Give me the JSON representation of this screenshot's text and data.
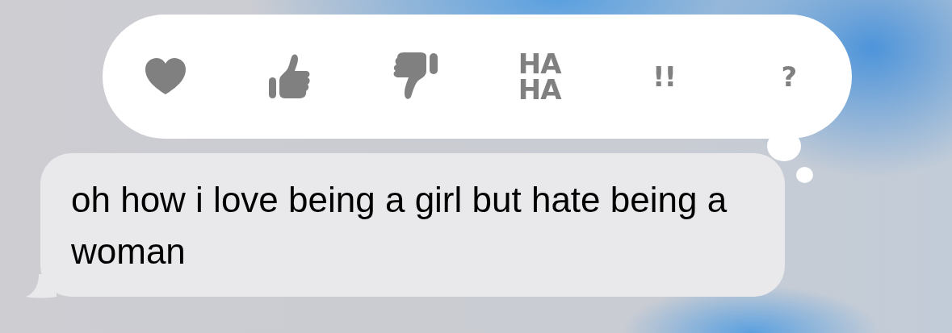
{
  "tapbacks": [
    {
      "kind": "heart"
    },
    {
      "kind": "thumbs_up"
    },
    {
      "kind": "thumbs_down"
    },
    {
      "kind": "text",
      "label": "HA HA"
    },
    {
      "kind": "text",
      "label": "!!"
    },
    {
      "kind": "text",
      "label": "?"
    }
  ],
  "message": {
    "text": "oh how i love being a girl but hate being a woman"
  }
}
